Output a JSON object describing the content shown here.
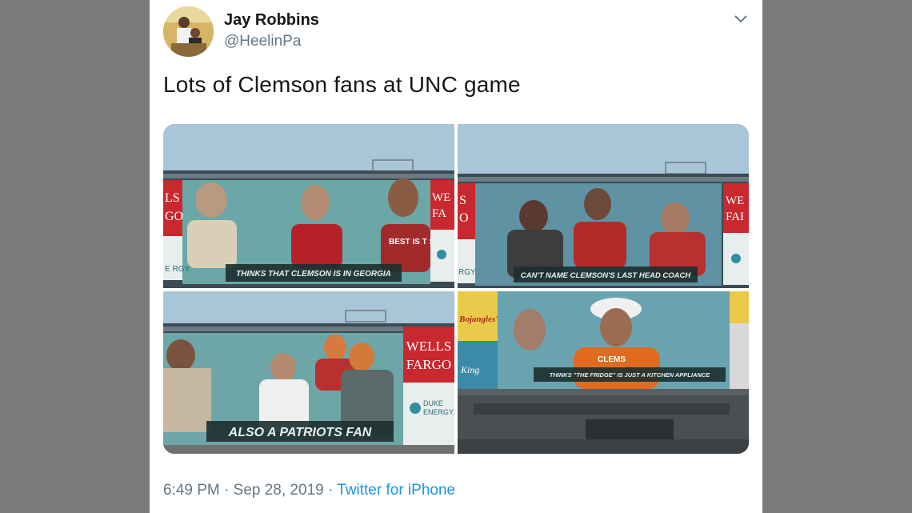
{
  "author": {
    "name": "Jay Robbins",
    "handle": "@HeelinPa"
  },
  "tweet": {
    "text": "Lots of Clemson fans at UNC game"
  },
  "photos": [
    {
      "caption": "THINKS THAT CLEMSON IS IN GEORGIA",
      "sign_right": [
        "WE",
        "FA"
      ],
      "sign_left": [
        "LS",
        "GO"
      ],
      "shirt_text": "BEST IS T STAN",
      "energy_left": "E RGY."
    },
    {
      "caption": "CAN'T NAME CLEMSON'S LAST HEAD COACH",
      "sign_right": [
        "WE",
        "FAI"
      ],
      "sign_left": [
        "S",
        "O"
      ],
      "energy_left": "RGY."
    },
    {
      "caption": "ALSO A PATRIOTS FAN",
      "sign_right": [
        "WELLS",
        "FARGO"
      ],
      "energy": [
        "DUKE",
        "ENERGY."
      ]
    },
    {
      "caption": "THINKS \"THE FRIDGE\" IS JUST A KITCHEN APPLIANCE",
      "sign_left": "Bojangles'",
      "sign_king": "King",
      "shirt_text": "CLEMS"
    }
  ],
  "meta": {
    "time": "6:49 PM",
    "sep1": " · ",
    "date": "Sep 28, 2019",
    "sep2": " · ",
    "source": "Twitter for iPhone"
  },
  "colors": {
    "background": "#7b7b7b",
    "link": "#1b95e0",
    "sky": "#a9c5d8",
    "wells_fargo_red": "#c8282e"
  },
  "icons": {
    "caret": "chevron-down-icon"
  }
}
